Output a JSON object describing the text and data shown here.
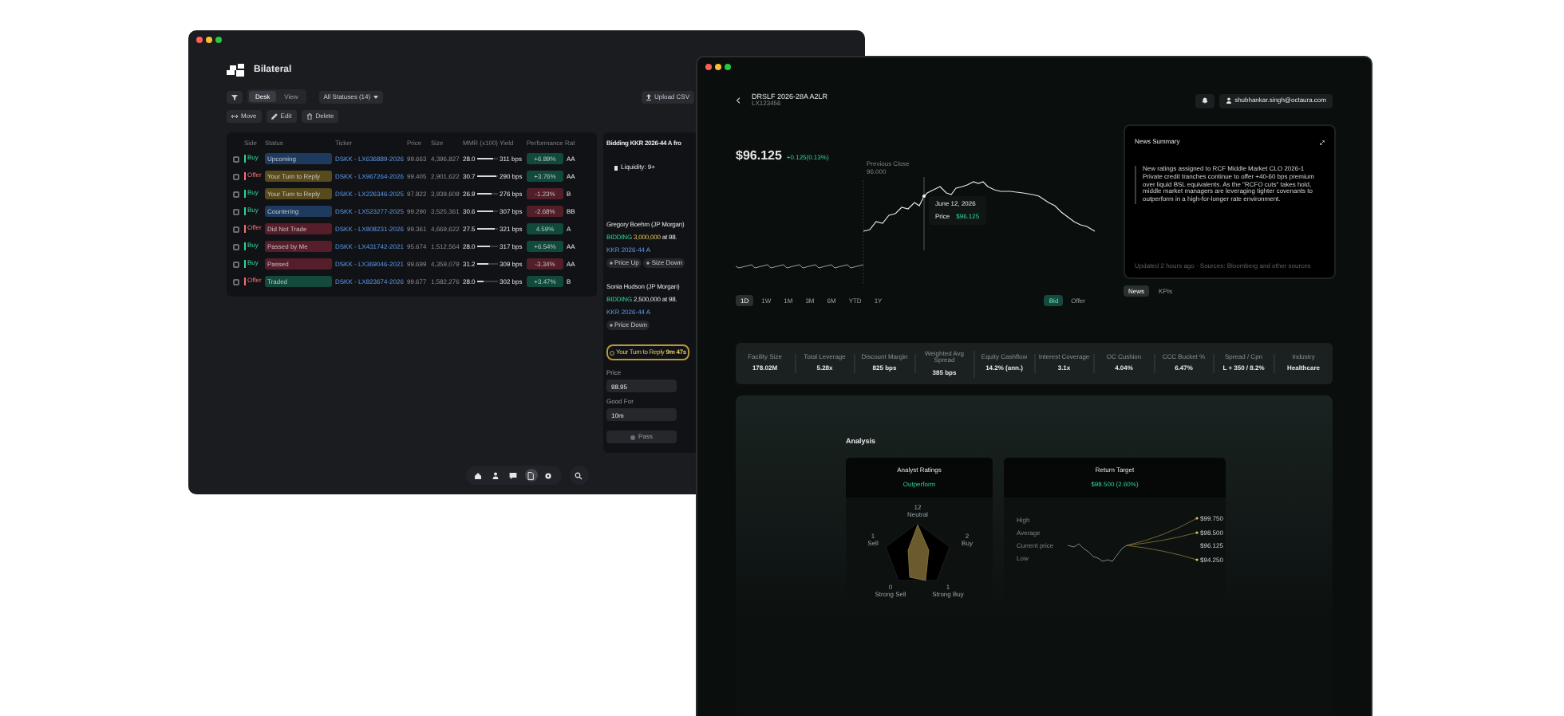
{
  "left_window": {
    "app_name": "Bilateral",
    "view_toggle": [
      {
        "label": "Desk",
        "selected": true
      },
      {
        "label": "View",
        "selected": false
      }
    ],
    "status_filter": "All Statuses (14)",
    "upload_button": "Upload CSV",
    "actions": [
      "Move",
      "Edit",
      "Delete"
    ],
    "table": {
      "columns": [
        "Side",
        "Status",
        "Ticker",
        "Price",
        "Size",
        "MMR (x100)",
        "Yield",
        "Performance",
        "Rat"
      ],
      "rows": [
        {
          "checked": false,
          "side": {
            "label": "Buy",
            "color": "#34d399"
          },
          "status": {
            "label": "Upcoming",
            "color": "#1f3a5f"
          },
          "ticker": "DSKK - LX636889-2026",
          "price": "99.663",
          "size": "4,396,827",
          "mmr": "28.0",
          "level": 0.8,
          "yield": "311 bps",
          "performance": {
            "value": "+6.89%",
            "color": "#11493a"
          },
          "rating": "AA"
        },
        {
          "checked": false,
          "side": {
            "label": "Offer",
            "color": "#f87171"
          },
          "status": {
            "label": "Your Turn to Reply",
            "color": "#574a1c"
          },
          "ticker": "DSKK - LX967264-2026",
          "price": "99.405",
          "size": "2,901,622",
          "mmr": "30.7",
          "level": 0.9,
          "yield": "290 bps",
          "performance": {
            "value": "+3.76%",
            "color": "#11493a"
          },
          "rating": "AA"
        },
        {
          "checked": false,
          "side": {
            "label": "Buy",
            "color": "#34d399"
          },
          "status": {
            "label": "Your Turn to Reply",
            "color": "#574a1c"
          },
          "ticker": "DSKK - LX226346-2025",
          "price": "97.822",
          "size": "3,939,609",
          "mmr": "26.9",
          "level": 0.7,
          "yield": "276 bps",
          "performance": {
            "value": "-1.23%",
            "color": "#521f29"
          },
          "rating": "B"
        },
        {
          "checked": false,
          "side": {
            "label": "Buy",
            "color": "#34d399"
          },
          "status": {
            "label": "Countering",
            "color": "#1f3a5f"
          },
          "ticker": "DSKK - LX523277-2025",
          "price": "99.290",
          "size": "3,525,361",
          "mmr": "30.6",
          "level": 0.75,
          "yield": "307 bps",
          "performance": {
            "value": "-2.68%",
            "color": "#521f29"
          },
          "rating": "BB"
        },
        {
          "checked": false,
          "side": {
            "label": "Offer",
            "color": "#f87171"
          },
          "status": {
            "label": "Did Not Trade",
            "color": "#551e2a"
          },
          "ticker": "DSKK - LX808231-2026",
          "price": "99.361",
          "size": "4,669,622",
          "mmr": "27.5",
          "level": 0.85,
          "yield": "321 bps",
          "performance": {
            "value": "4.59%",
            "color": "#11493a"
          },
          "rating": "A"
        },
        {
          "checked": false,
          "side": {
            "label": "Buy",
            "color": "#34d399"
          },
          "status": {
            "label": "Passed by Me",
            "color": "#551e2a"
          },
          "ticker": "DSKK - LX431742-2021",
          "price": "95.674",
          "size": "1,512,564",
          "mmr": "28.0",
          "level": 0.6,
          "yield": "317 bps",
          "performance": {
            "value": "+6.54%",
            "color": "#11493a"
          },
          "rating": "AA"
        },
        {
          "checked": false,
          "side": {
            "label": "Buy",
            "color": "#34d399"
          },
          "status": {
            "label": "Passed",
            "color": "#551e2a"
          },
          "ticker": "DSKK - LX369046-2021",
          "price": "99.699",
          "size": "4,359,079",
          "mmr": "31.2",
          "level": 0.55,
          "yield": "309 bps",
          "performance": {
            "value": "-3.34%",
            "color": "#521f29"
          },
          "rating": "AA"
        },
        {
          "checked": false,
          "side": {
            "label": "Offer",
            "color": "#f87171"
          },
          "status": {
            "label": "Traded",
            "color": "#144a3c"
          },
          "ticker": "DSKK - LX823674-2026",
          "price": "99.677",
          "size": "1,582,276",
          "mmr": "28.0",
          "level": 0.3,
          "yield": "302 bps",
          "performance": {
            "value": "+3.47%",
            "color": "#11493a"
          },
          "rating": "B"
        }
      ]
    },
    "side_panel": {
      "title": "Bidding KKR 2026-44 A fro",
      "liquidity": "Liquidity: 9+",
      "quotes": [
        {
          "trader": "Gregory Boehm (JP Morgan)",
          "action": "BIDDING",
          "size": {
            "text": "3,000,000",
            "highlighted": true
          },
          "price": "at 98.",
          "ticker": "KKR 2026-44 A",
          "buttons": [
            "Price Up",
            "Size Down"
          ]
        },
        {
          "trader": "Sonia Hudson (JP Morgan)",
          "action": "BIDDING",
          "size": {
            "text": "2,500,000",
            "highlighted": false
          },
          "price": "at 98.",
          "ticker": "KKR 2026-44 A",
          "buttons": [
            "Price Down"
          ]
        }
      ],
      "turn_status": "Your Turn to Reply",
      "turn_timer": "9m 47s",
      "price_label": "Price",
      "price_value": "98.95",
      "good_for_label": "Good For",
      "good_for_value": "10m",
      "pass_button": "Pass"
    },
    "dock": [
      {
        "selected": false
      },
      {
        "selected": false
      },
      {
        "selected": false
      },
      {
        "selected": true
      },
      {
        "selected": false
      },
      {
        "selected": false
      }
    ]
  },
  "right_window": {
    "title": "DRSLF 2026-28A A2LR",
    "subtitle": "LX123456",
    "user": "shubhankar.singh@octaura.com",
    "price": "$96.125",
    "change": "+0.125(0.13%)",
    "chart": {
      "previous_close_label": "Previous Close",
      "previous_close_value": "96.000",
      "tooltip_date": "June 12, 2026",
      "tooltip_label": "Price",
      "tooltip_value": "$96.125"
    },
    "ranges": [
      {
        "label": "1D",
        "selected": true
      },
      {
        "label": "1W",
        "selected": false
      },
      {
        "label": "1M",
        "selected": false
      },
      {
        "label": "3M",
        "selected": false
      },
      {
        "label": "6M",
        "selected": false
      },
      {
        "label": "YTD",
        "selected": false
      },
      {
        "label": "1Y",
        "selected": false
      }
    ],
    "sides": [
      {
        "label": "Bid",
        "selected": true
      },
      {
        "label": "Offer",
        "selected": false
      }
    ],
    "news": {
      "title": "News Summary",
      "text": "New ratings assigned to RCF Middle Market CLO 2026-1 Private credit tranches continue to offer +40-60 bps premium over liquid BSL equivalents. As the \"RCFO cuts\" takes hold, middle market managers are leveraging tighter covenants to outperform in a high-for-longer rate environment.",
      "footnote": "Updated 2 hours ago · Sources: Bloomberg and other sources"
    },
    "tabs": [
      {
        "label": "News",
        "selected": true
      },
      {
        "label": "KPIs",
        "selected": false
      }
    ],
    "metrics": [
      {
        "label": "Facility Size",
        "value": "178.02M"
      },
      {
        "label": "Total Leverage",
        "value": "5.28x"
      },
      {
        "label": "Discount Margin",
        "value": "825 bps"
      },
      {
        "label": "Weighted Avg Spread",
        "value": "385 bps"
      },
      {
        "label": "Equity Cashflow",
        "value": "14.2% (ann.)"
      },
      {
        "label": "Interest Coverage",
        "value": "3.1x"
      },
      {
        "label": "OC Cushion",
        "value": "4.04%"
      },
      {
        "label": "CCC Bucket %",
        "value": "6.47%"
      },
      {
        "label": "Spread / Cpn",
        "value": "L + 350 / 8.2%"
      },
      {
        "label": "Industry",
        "value": "Healthcare"
      }
    ],
    "analysis": {
      "title": "Analysis",
      "ratings": {
        "title": "Analyst Ratings",
        "subtitle": "Outperform",
        "axes": [
          {
            "label": "Neutral",
            "count": "12"
          },
          {
            "label": "Sell",
            "count": "1"
          },
          {
            "label": "Buy",
            "count": "2"
          },
          {
            "label": "Strong Sell",
            "count": "0"
          },
          {
            "label": "Strong Buy",
            "count": "1"
          }
        ]
      },
      "target": {
        "title": "Return Target",
        "subtitle": "$98.500 (2.60%)",
        "levels": [
          {
            "label": "High",
            "value": "$99.750"
          },
          {
            "label": "Average",
            "value": "$98.500"
          },
          {
            "label": "Current price",
            "value": "$96.125"
          },
          {
            "label": "Low",
            "value": "$94.250"
          }
        ]
      }
    }
  }
}
